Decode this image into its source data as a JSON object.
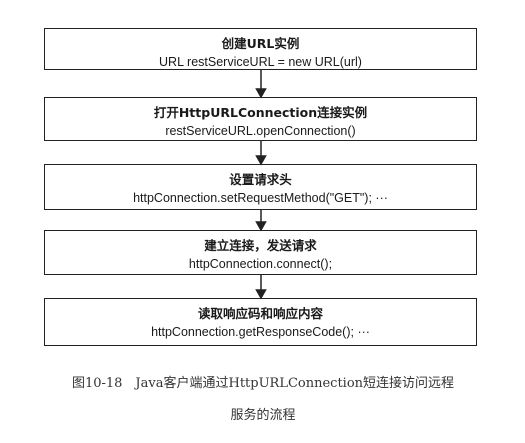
{
  "steps": [
    {
      "title": "创建URL实例",
      "code": "URL restServiceURL = new URL(url)"
    },
    {
      "title": "打开HttpURLConnection连接实例",
      "code": "restServiceURL.openConnection()"
    },
    {
      "title": "设置请求头",
      "code": "httpConnection.setRequestMethod(\"GET\");     ···"
    },
    {
      "title": "建立连接，发送请求",
      "code": "httpConnection.connect();"
    },
    {
      "title": "读取响应码和响应内容",
      "code": "httpConnection.getResponseCode();     ···"
    }
  ],
  "caption": {
    "line1": "图10-18　Java客户端通过HttpURLConnection短连接访问远程",
    "line2": "服务的流程"
  }
}
